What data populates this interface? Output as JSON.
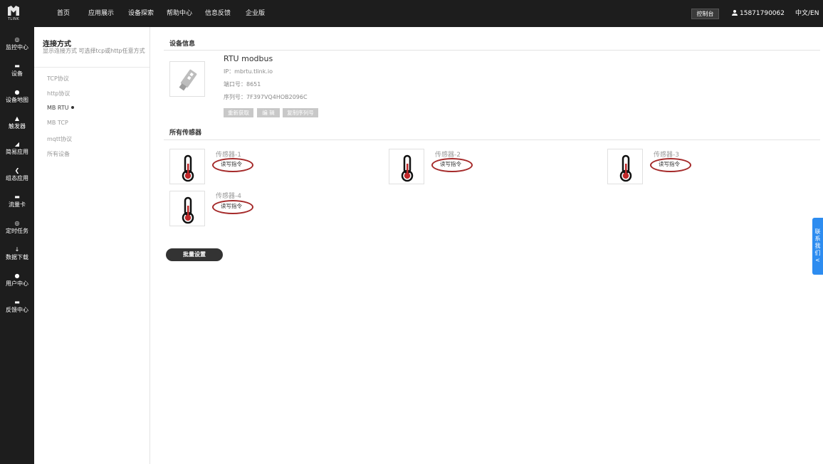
{
  "logo": {
    "text": "TLINK"
  },
  "top_nav": [
    {
      "label": "首页"
    },
    {
      "label": "应用展示"
    },
    {
      "label": "设备探索"
    },
    {
      "label": "帮助中心"
    },
    {
      "label": "信息反馈"
    },
    {
      "label": "企业版"
    }
  ],
  "header": {
    "console_label": "控制台",
    "user_phone": "15871790062",
    "lang_label": "中文/EN"
  },
  "sidebar": {
    "items": [
      {
        "label": "监控中心",
        "icon": "◎"
      },
      {
        "label": "设备",
        "icon": "▬"
      },
      {
        "label": "设备地图",
        "icon": "●"
      },
      {
        "label": "触发器",
        "icon": "▲"
      },
      {
        "label": "简易应用",
        "icon": "◢"
      },
      {
        "label": "组态应用",
        "icon": "❮"
      },
      {
        "label": "流量卡",
        "icon": "▬"
      },
      {
        "label": "定时任务",
        "icon": "◎"
      },
      {
        "label": "数据下载",
        "icon": "↓"
      },
      {
        "label": "用户中心",
        "icon": "●"
      },
      {
        "label": "反馈中心",
        "icon": "▬"
      }
    ]
  },
  "subnav": {
    "title": "连接方式",
    "description": "显示连接方式 可选择tcp或http任意方式",
    "protocols": [
      {
        "label": "TCP协议"
      },
      {
        "label": "http协议"
      },
      {
        "label": "MB RTU"
      },
      {
        "label": "MB TCP"
      },
      {
        "label": "mqtt协议"
      },
      {
        "label": "所有设备"
      }
    ]
  },
  "device": {
    "section_title": "设备信息",
    "name": "RTU modbus",
    "ip": "IP：mbrtu.tlink.io",
    "port": "端口号：8651",
    "serial": "序列号：7F397VQ4HOB2096C",
    "buttons": {
      "refresh": "重新获取",
      "edit": "编 辑",
      "copy_serial": "复制序列号"
    }
  },
  "sensors": {
    "section_title": "所有传感器",
    "items": [
      {
        "name": "传感器-1",
        "command": "读写指令"
      },
      {
        "name": "传感器-2",
        "command": "读写指令"
      },
      {
        "name": "传感器-3",
        "command": "读写指令"
      },
      {
        "name": "传感器-4",
        "command": "读写指令"
      }
    ],
    "batch_label": "批量设置"
  },
  "contact_tab": {
    "text": [
      "联",
      "系",
      "我",
      "们",
      "<"
    ]
  },
  "colors": {
    "header_bg": "#1d1d1d",
    "accent_blue": "#2d8cf0",
    "highlight_ellipse": "#a52a2a",
    "thermo_red": "#c0282a"
  }
}
